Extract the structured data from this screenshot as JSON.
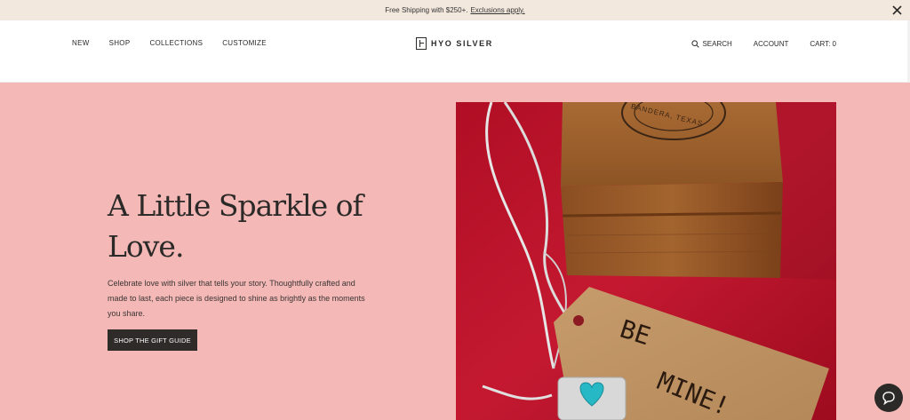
{
  "announcement": {
    "text": "Free Shipping with $250+.",
    "link": "Exclusions apply."
  },
  "header": {
    "nav_left": [
      "NEW",
      "SHOP",
      "COLLECTIONS",
      "CUSTOMIZE"
    ],
    "logo": "HYO SILVER",
    "search": "SEARCH",
    "account": "ACCOUNT",
    "cart": "CART: 0"
  },
  "hero": {
    "title": "A Little Sparkle of Love.",
    "body": "Celebrate love with silver that tells your story. Thoughtfully crafted and made to last, each piece is designed to shine as brightly as the moments you share.",
    "cta": "SHOP THE GIFT GUIDE",
    "tag_text_1": "BE",
    "tag_text_2": "MINE!",
    "box_stamp": "BANDERA, TEXAS"
  },
  "colors": {
    "hero_bg": "#f4b8b6",
    "announcement_bg": "#f3e8de",
    "button_bg": "#2e2b29"
  }
}
